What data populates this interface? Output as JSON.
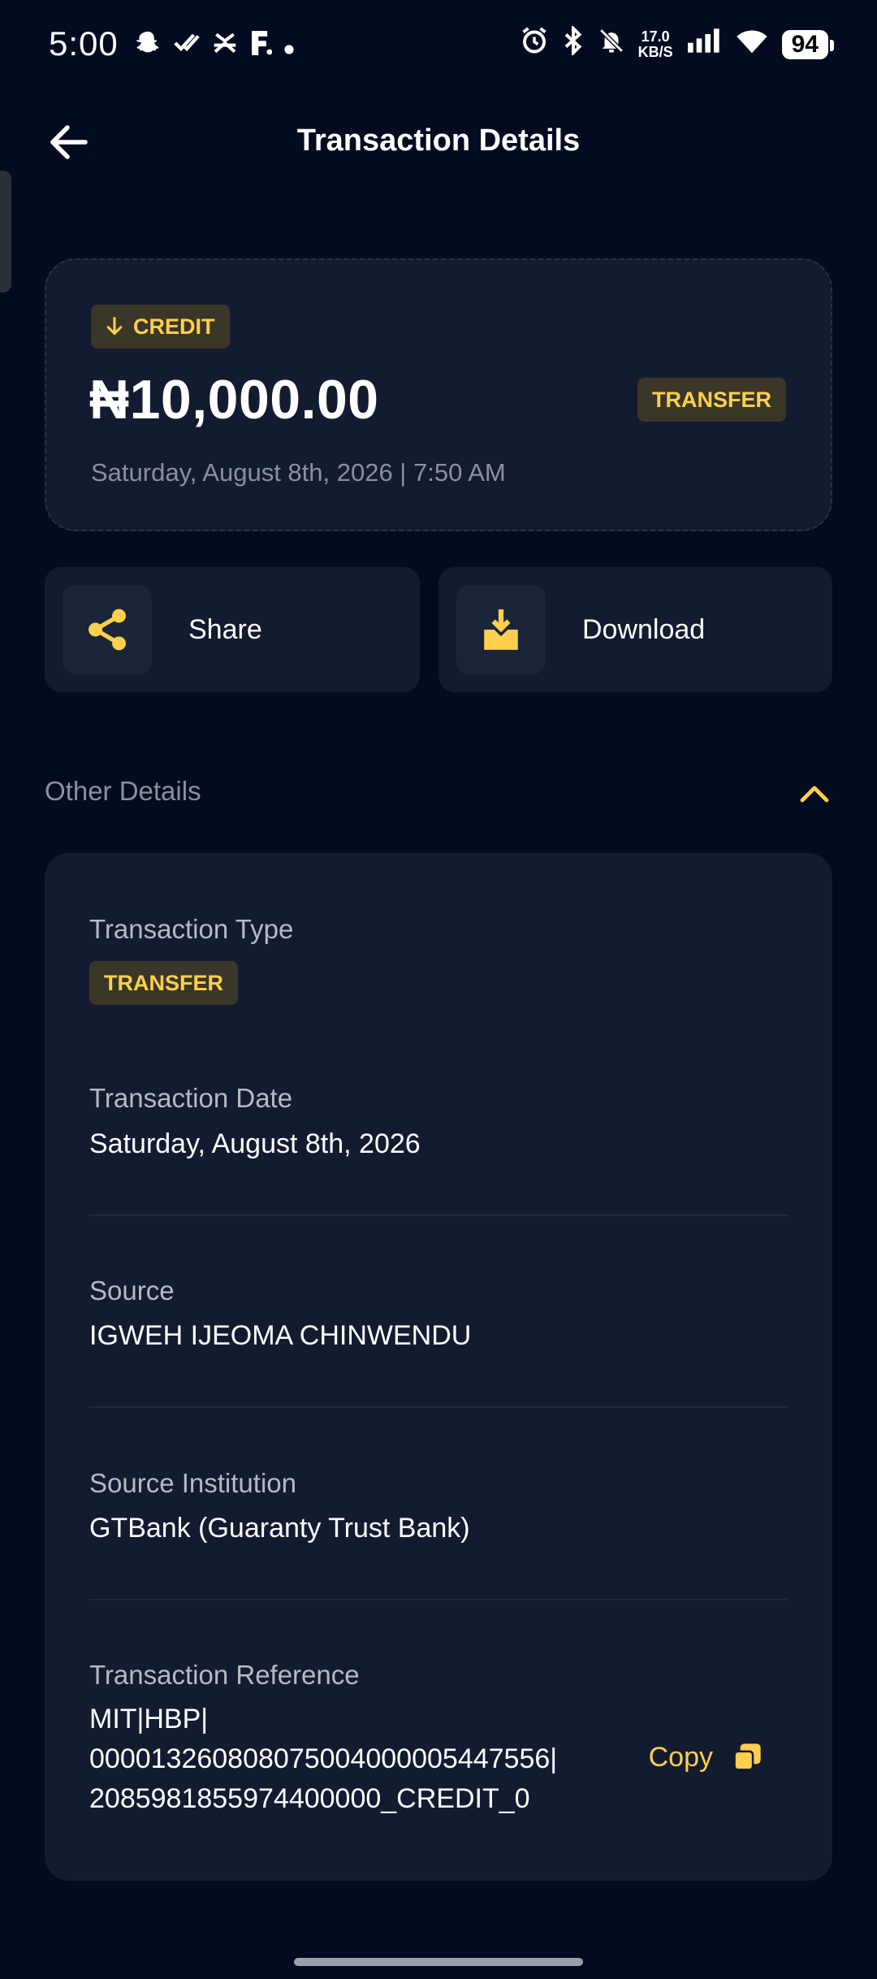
{
  "status_bar": {
    "time": "5:00",
    "net_speed_value": "17.0",
    "net_speed_unit": "KB/S",
    "battery": "94"
  },
  "header": {
    "title": "Transaction Details"
  },
  "summary": {
    "direction_badge": "CREDIT",
    "amount": "₦10,000.00",
    "type_badge": "TRANSFER",
    "datetime": "Saturday, August 8th, 2026 | 7:50 AM"
  },
  "actions": {
    "share_label": "Share",
    "download_label": "Download"
  },
  "other_details": {
    "section_label": "Other Details",
    "transaction_type_label": "Transaction Type",
    "transaction_type_value": "TRANSFER",
    "transaction_date_label": "Transaction Date",
    "transaction_date_value": "Saturday, August 8th, 2026",
    "source_label": "Source",
    "source_value": "IGWEH IJEOMA CHINWENDU",
    "source_institution_label": "Source Institution",
    "source_institution_value": "GTBank (Guaranty Trust Bank)",
    "reference_label": "Transaction Reference",
    "reference_line1": "MIT|HBP|",
    "reference_line2": "000013260808075004000005447556|",
    "reference_line3": "2085981855974400000_CREDIT_0",
    "copy_label": "Copy"
  },
  "colors": {
    "background": "#020b1f",
    "card": "#121b30",
    "accent": "#ffcf4d"
  }
}
